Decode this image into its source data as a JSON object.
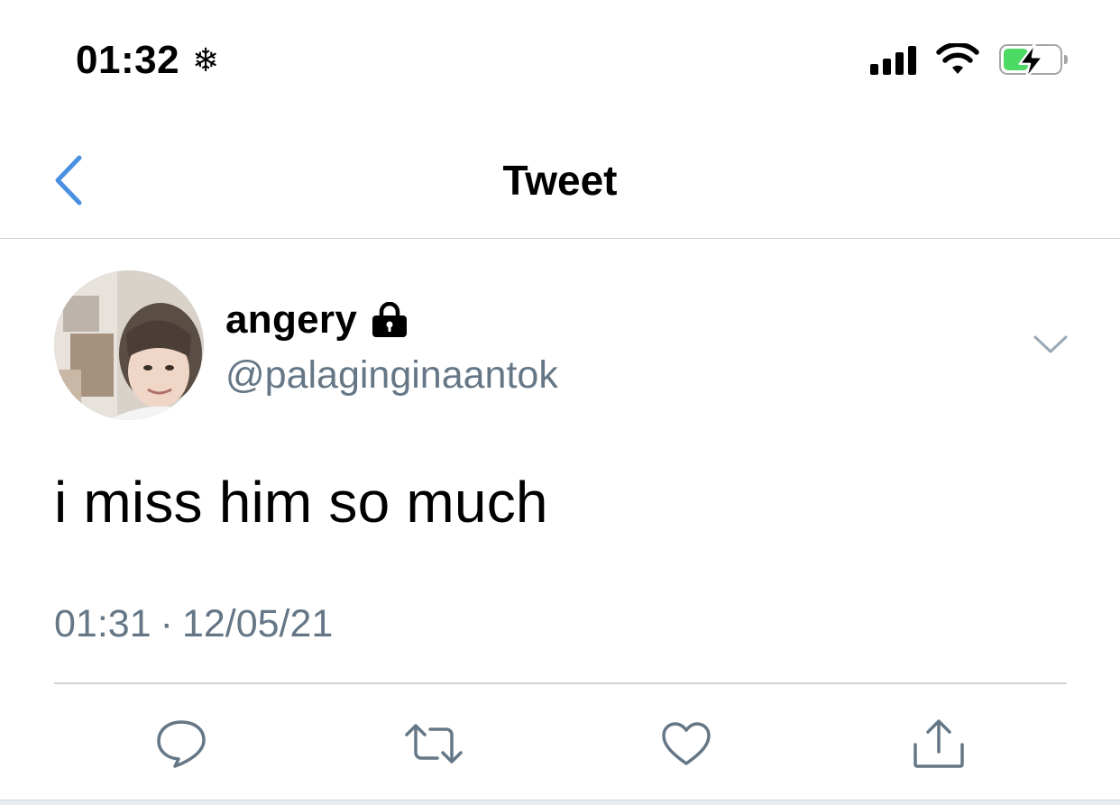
{
  "status_bar": {
    "time": "01:32",
    "status_icon": "snowflake-icon",
    "signal_icon": "cellular-signal-icon",
    "wifi_icon": "wifi-icon",
    "battery_icon": "battery-charging-icon",
    "battery_level": 0.45,
    "battery_color": "#4cd964"
  },
  "nav": {
    "back_icon": "chevron-left-icon",
    "title": "Tweet",
    "accent_color": "#4a90e2"
  },
  "tweet": {
    "author": {
      "display_name": "angery",
      "protected_icon": "lock-icon",
      "handle": "@palaginginaantok",
      "avatar": "avatar-photo"
    },
    "menu_icon": "chevron-down-icon",
    "text": "i miss him so much",
    "time": "01:31",
    "separator": "·",
    "date": "12/05/21"
  },
  "actions": [
    {
      "name": "reply",
      "icon": "reply-icon"
    },
    {
      "name": "retweet",
      "icon": "retweet-icon"
    },
    {
      "name": "like",
      "icon": "heart-icon"
    },
    {
      "name": "share",
      "icon": "share-icon"
    }
  ],
  "colors": {
    "secondary_text": "#657786",
    "divider": "#d0d4d8",
    "icon_gray": "#657786"
  }
}
